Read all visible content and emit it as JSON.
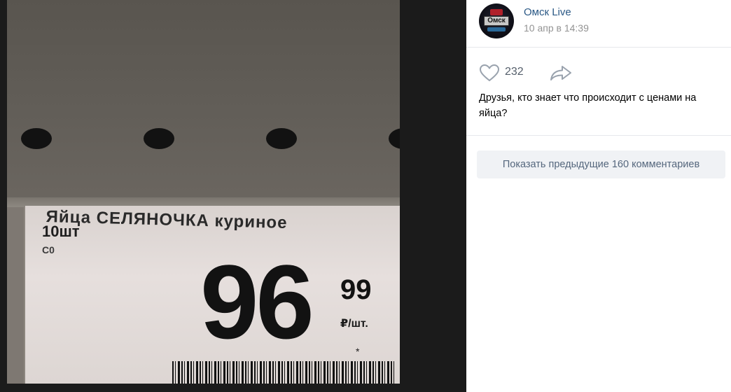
{
  "photo": {
    "tag": {
      "product_name": "Яйца СЕЛЯНОЧКА куриное",
      "quantity": "10шт",
      "grade": "С0",
      "price_rubles": "96",
      "price_kopecks": "99",
      "unit": "₽/шт.",
      "mark": "*"
    }
  },
  "post": {
    "group_name": "Омск Live",
    "avatar_text": "Омск",
    "date": "10 апр в 14:39",
    "likes": "232",
    "text": "Друзья, кто знает что происходит с ценами на яйца?",
    "show_comments_label": "Показать предыдущие 160 комментариев"
  },
  "icons": {
    "like": "heart-outline-icon",
    "share": "share-arrow-icon"
  },
  "colors": {
    "link": "#2a5885",
    "muted": "#939393",
    "button_bg": "#f0f2f5",
    "button_text": "#55677d"
  }
}
